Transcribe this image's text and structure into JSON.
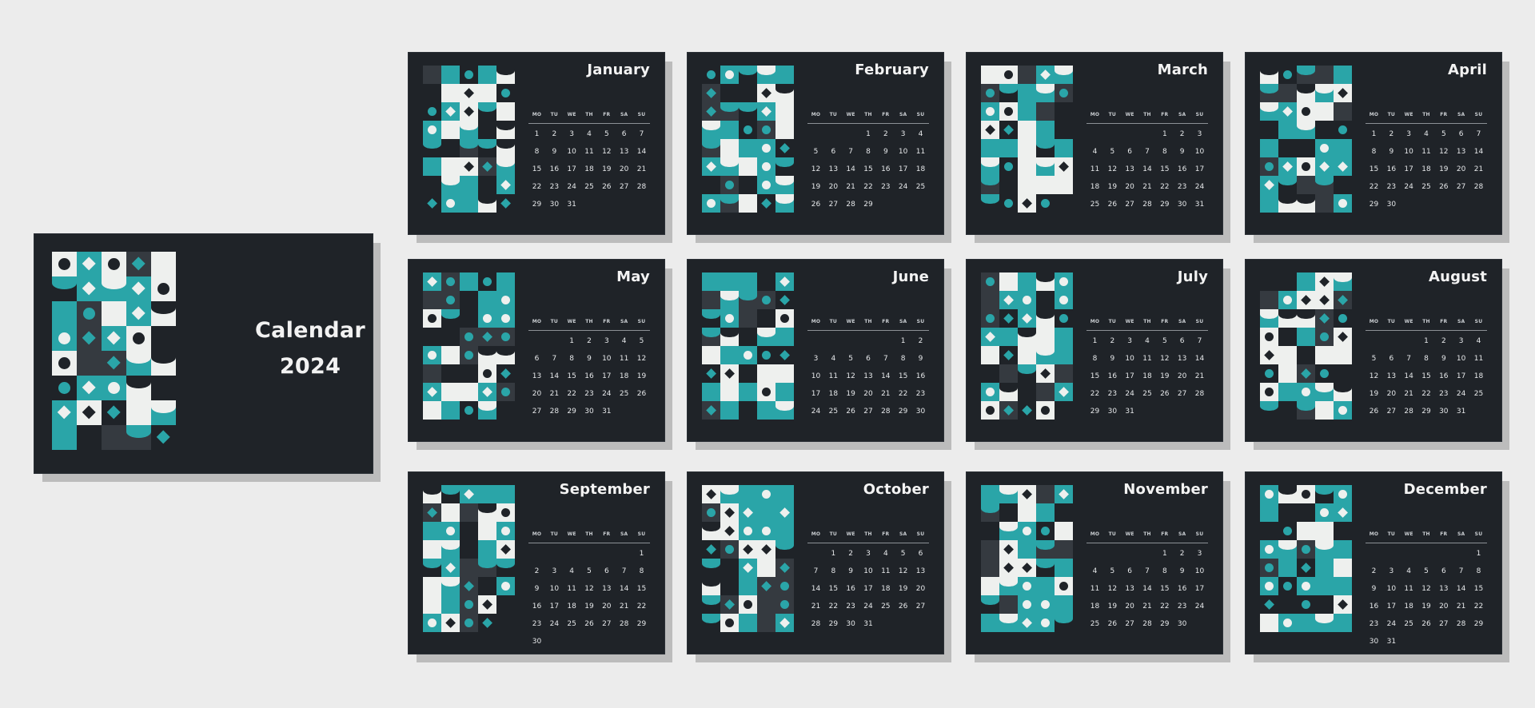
{
  "cover": {
    "title_line1": "Calendar",
    "title_line2": "2024"
  },
  "weekdays": [
    "MO",
    "TU",
    "WE",
    "TH",
    "FR",
    "SA",
    "SU"
  ],
  "colors": {
    "background": "#ececec",
    "card": "#1f2328",
    "accent": "#2aa5a8",
    "light": "#eef0ee",
    "shadow": "#bcbcbc"
  },
  "months": [
    {
      "name": "January",
      "weeks": [
        [
          "1",
          "2",
          "3",
          "4",
          "5",
          "6",
          "7"
        ],
        [
          "8",
          "9",
          "10",
          "11",
          "12",
          "13",
          "14"
        ],
        [
          "15",
          "16",
          "17",
          "18",
          "19",
          "20",
          "21"
        ],
        [
          "22",
          "23",
          "24",
          "25",
          "26",
          "27",
          "28"
        ],
        [
          "29",
          "30",
          "31",
          "",
          "",
          "",
          ""
        ]
      ]
    },
    {
      "name": "February",
      "weeks": [
        [
          "",
          "",
          "",
          "1",
          "2",
          "3",
          "4"
        ],
        [
          "5",
          "6",
          "7",
          "8",
          "9",
          "10",
          "11"
        ],
        [
          "12",
          "13",
          "14",
          "15",
          "16",
          "17",
          "18"
        ],
        [
          "19",
          "20",
          "21",
          "22",
          "23",
          "24",
          "25"
        ],
        [
          "26",
          "27",
          "28",
          "29",
          "",
          "",
          ""
        ]
      ]
    },
    {
      "name": "March",
      "weeks": [
        [
          "",
          "",
          "",
          "",
          "1",
          "2",
          "3"
        ],
        [
          "4",
          "5",
          "6",
          "7",
          "8",
          "9",
          "10"
        ],
        [
          "11",
          "12",
          "13",
          "14",
          "15",
          "16",
          "17"
        ],
        [
          "18",
          "19",
          "20",
          "21",
          "22",
          "23",
          "24"
        ],
        [
          "25",
          "26",
          "27",
          "28",
          "29",
          "30",
          "31"
        ]
      ]
    },
    {
      "name": "April",
      "weeks": [
        [
          "1",
          "2",
          "3",
          "4",
          "5",
          "6",
          "7"
        ],
        [
          "8",
          "9",
          "10",
          "11",
          "12",
          "13",
          "14"
        ],
        [
          "15",
          "16",
          "17",
          "18",
          "19",
          "20",
          "21"
        ],
        [
          "22",
          "23",
          "24",
          "25",
          "26",
          "27",
          "28"
        ],
        [
          "29",
          "30",
          "",
          "",
          "",
          "",
          ""
        ]
      ]
    },
    {
      "name": "May",
      "weeks": [
        [
          "",
          "",
          "1",
          "2",
          "3",
          "4",
          "5"
        ],
        [
          "6",
          "7",
          "8",
          "9",
          "10",
          "11",
          "12"
        ],
        [
          "13",
          "14",
          "15",
          "16",
          "17",
          "18",
          "19"
        ],
        [
          "20",
          "21",
          "22",
          "23",
          "24",
          "25",
          "26"
        ],
        [
          "27",
          "28",
          "29",
          "30",
          "31",
          "",
          ""
        ]
      ]
    },
    {
      "name": "June",
      "weeks": [
        [
          "",
          "",
          "",
          "",
          "",
          "1",
          "2"
        ],
        [
          "3",
          "4",
          "5",
          "6",
          "7",
          "8",
          "9"
        ],
        [
          "10",
          "11",
          "12",
          "13",
          "14",
          "15",
          "16"
        ],
        [
          "17",
          "18",
          "19",
          "20",
          "21",
          "22",
          "23"
        ],
        [
          "24",
          "25",
          "26",
          "27",
          "28",
          "29",
          "30"
        ]
      ]
    },
    {
      "name": "July",
      "weeks": [
        [
          "1",
          "2",
          "3",
          "4",
          "5",
          "6",
          "7"
        ],
        [
          "8",
          "9",
          "10",
          "11",
          "12",
          "13",
          "14"
        ],
        [
          "15",
          "16",
          "17",
          "18",
          "19",
          "20",
          "21"
        ],
        [
          "22",
          "23",
          "24",
          "25",
          "26",
          "27",
          "28"
        ],
        [
          "29",
          "30",
          "31",
          "",
          "",
          "",
          ""
        ]
      ]
    },
    {
      "name": "August",
      "weeks": [
        [
          "",
          "",
          "",
          "1",
          "2",
          "3",
          "4"
        ],
        [
          "5",
          "6",
          "7",
          "8",
          "9",
          "10",
          "11"
        ],
        [
          "12",
          "13",
          "14",
          "15",
          "16",
          "17",
          "18"
        ],
        [
          "19",
          "20",
          "21",
          "22",
          "23",
          "24",
          "25"
        ],
        [
          "26",
          "27",
          "28",
          "29",
          "30",
          "31",
          ""
        ]
      ]
    },
    {
      "name": "September",
      "weeks": [
        [
          "",
          "",
          "",
          "",
          "",
          "",
          "1"
        ],
        [
          "2",
          "3",
          "4",
          "5",
          "6",
          "7",
          "8"
        ],
        [
          "9",
          "10",
          "11",
          "12",
          "13",
          "14",
          "15"
        ],
        [
          "16",
          "17",
          "18",
          "19",
          "20",
          "21",
          "22"
        ],
        [
          "23",
          "24",
          "25",
          "26",
          "27",
          "28",
          "29"
        ],
        [
          "30",
          "",
          "",
          "",
          "",
          "",
          ""
        ]
      ]
    },
    {
      "name": "October",
      "weeks": [
        [
          "",
          "1",
          "2",
          "3",
          "4",
          "5",
          "6"
        ],
        [
          "7",
          "8",
          "9",
          "10",
          "11",
          "12",
          "13"
        ],
        [
          "14",
          "15",
          "16",
          "17",
          "18",
          "19",
          "20"
        ],
        [
          "21",
          "22",
          "23",
          "24",
          "25",
          "26",
          "27"
        ],
        [
          "28",
          "29",
          "30",
          "31",
          "",
          "",
          ""
        ]
      ]
    },
    {
      "name": "November",
      "weeks": [
        [
          "",
          "",
          "",
          "",
          "1",
          "2",
          "3"
        ],
        [
          "4",
          "5",
          "6",
          "7",
          "8",
          "9",
          "10"
        ],
        [
          "11",
          "12",
          "13",
          "14",
          "15",
          "16",
          "17"
        ],
        [
          "18",
          "19",
          "20",
          "21",
          "22",
          "23",
          "24"
        ],
        [
          "25",
          "26",
          "27",
          "28",
          "29",
          "30",
          ""
        ]
      ]
    },
    {
      "name": "December",
      "weeks": [
        [
          "",
          "",
          "",
          "",
          "",
          "",
          "1"
        ],
        [
          "2",
          "3",
          "4",
          "5",
          "6",
          "7",
          "8"
        ],
        [
          "9",
          "10",
          "11",
          "12",
          "13",
          "14",
          "15"
        ],
        [
          "16",
          "17",
          "18",
          "19",
          "20",
          "21",
          "22"
        ],
        [
          "23",
          "24",
          "25",
          "26",
          "27",
          "28",
          "29"
        ],
        [
          "30",
          "31",
          "",
          "",
          "",
          "",
          ""
        ]
      ]
    }
  ]
}
